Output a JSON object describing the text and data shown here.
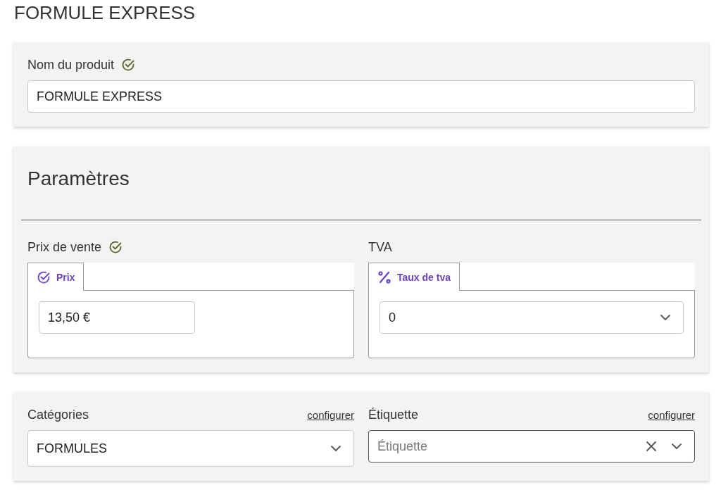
{
  "page_title": "FORMULE EXPRESS",
  "product_name": {
    "label": "Nom du produit",
    "validated": true,
    "value": "FORMULE EXPRESS"
  },
  "parameters": {
    "title": "Paramètres",
    "price": {
      "label": "Prix de vente",
      "validated": true,
      "tabs": [
        {
          "label": "Prix",
          "kind": "check",
          "selected": true
        }
      ],
      "value": "13,50 €"
    },
    "vat": {
      "label": "TVA",
      "validated": false,
      "tabs": [
        {
          "label": "Taux de tva",
          "kind": "percent",
          "selected": true
        }
      ],
      "value": "0"
    }
  },
  "classification": [
    {
      "label": "Catégories",
      "link": "configurer",
      "value": "FORMULES",
      "clearable": false,
      "focused": false
    },
    {
      "label": "Étiquette",
      "link": "configurer",
      "placeholder": "Étiquette",
      "clearable": true,
      "focused": true
    }
  ]
}
